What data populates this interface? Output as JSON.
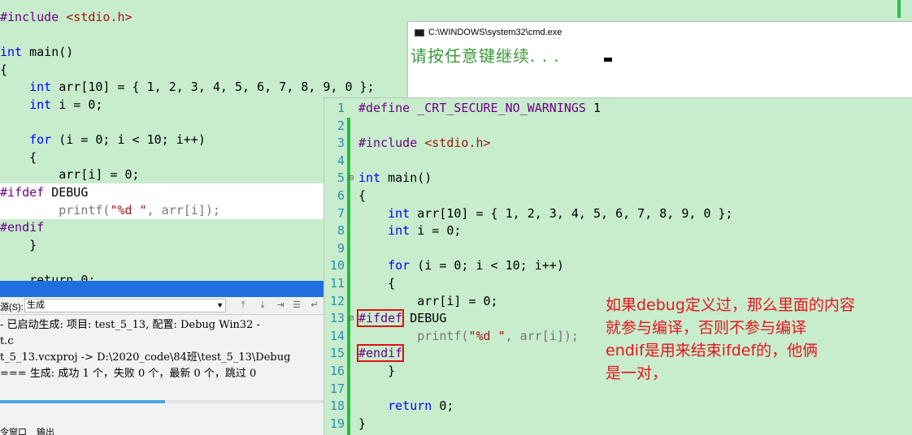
{
  "background_editor": {
    "lines": [
      [
        {
          "t": "#include ",
          "c": "pp"
        },
        {
          "t": "<stdio.h>",
          "c": "str"
        }
      ],
      [],
      [
        {
          "t": "int",
          "c": "kw"
        },
        {
          "t": " main()",
          "c": ""
        }
      ],
      [
        {
          "t": "{",
          "c": ""
        }
      ],
      [
        {
          "t": "    ",
          "c": ""
        },
        {
          "t": "int",
          "c": "kw"
        },
        {
          "t": " arr[10] = { 1, 2, 3, 4, 5, 6, 7, 8, 9, 0 };",
          "c": ""
        }
      ],
      [
        {
          "t": "    ",
          "c": ""
        },
        {
          "t": "int",
          "c": "kw"
        },
        {
          "t": " i = 0;",
          "c": ""
        }
      ],
      [],
      [
        {
          "t": "    ",
          "c": ""
        },
        {
          "t": "for",
          "c": "kw"
        },
        {
          "t": " (i = 0; i < 10; i++)",
          "c": ""
        }
      ],
      [
        {
          "t": "    {",
          "c": ""
        }
      ],
      [
        {
          "t": "        arr[i] = 0;",
          "c": ""
        }
      ],
      [
        {
          "t": "#ifdef",
          "c": "pp"
        },
        {
          "t": " DEBUG",
          "c": ""
        }
      ],
      [
        {
          "t": "        printf(",
          "c": "dim"
        },
        {
          "t": "\"%d \"",
          "c": "str"
        },
        {
          "t": ", arr[i]);",
          "c": "dim"
        }
      ],
      [
        {
          "t": "#endif",
          "c": "pp"
        }
      ],
      [
        {
          "t": "    }",
          "c": ""
        }
      ],
      [],
      [
        {
          "t": "    return 0;",
          "c": ""
        }
      ]
    ]
  },
  "console": {
    "title": "C:\\WINDOWS\\system32\\cmd.exe",
    "icon": "console-icon",
    "message": "请按任意键继续. . ."
  },
  "output_panel": {
    "source_label": "源(S):",
    "source_value": "生成",
    "lines": [
      "- 已启动生成: 项目: test_5_13, 配置: Debug Win32 -",
      "t.c",
      "t_5_13.vcxproj -> D:\\2020_code\\84班\\test_5_13\\Debug",
      "=== 生成: 成功 1 个，失败 0 个，最新 0 个，跳过 0"
    ],
    "progress": 0.51,
    "tabs": [
      "令窗口",
      "输出"
    ]
  },
  "editor": {
    "lines": [
      {
        "n": "1",
        "fold": "",
        "boxed": false,
        "tokens": [
          {
            "t": "#define",
            "c": "pp"
          },
          {
            "t": " ",
            "c": ""
          },
          {
            "t": "_CRT_SECURE_NO_WARNINGS",
            "c": "mac"
          },
          {
            "t": " 1",
            "c": ""
          }
        ]
      },
      {
        "n": "2",
        "fold": "",
        "boxed": false,
        "tokens": []
      },
      {
        "n": "3",
        "fold": "",
        "boxed": false,
        "tokens": [
          {
            "t": "#include",
            "c": "pp"
          },
          {
            "t": " ",
            "c": ""
          },
          {
            "t": "<stdio.h>",
            "c": "str"
          }
        ]
      },
      {
        "n": "4",
        "fold": "",
        "boxed": false,
        "tokens": []
      },
      {
        "n": "5",
        "fold": "⊟",
        "boxed": false,
        "tokens": [
          {
            "t": "int",
            "c": "kw"
          },
          {
            "t": " main()",
            "c": ""
          }
        ]
      },
      {
        "n": "6",
        "fold": "",
        "boxed": false,
        "tokens": [
          {
            "t": "{",
            "c": ""
          }
        ]
      },
      {
        "n": "7",
        "fold": "",
        "boxed": false,
        "tokens": [
          {
            "t": "    ",
            "c": ""
          },
          {
            "t": "int",
            "c": "kw"
          },
          {
            "t": " arr[10] = { 1, 2, 3, 4, 5, 6, 7, 8, 9, 0 };",
            "c": ""
          }
        ]
      },
      {
        "n": "8",
        "fold": "",
        "boxed": false,
        "tokens": [
          {
            "t": "    ",
            "c": ""
          },
          {
            "t": "int",
            "c": "kw"
          },
          {
            "t": " i = 0;",
            "c": ""
          }
        ]
      },
      {
        "n": "9",
        "fold": "",
        "boxed": false,
        "tokens": []
      },
      {
        "n": "10",
        "fold": "",
        "boxed": false,
        "tokens": [
          {
            "t": "    ",
            "c": ""
          },
          {
            "t": "for",
            "c": "kw"
          },
          {
            "t": " (i = 0; i < 10; i++)",
            "c": ""
          }
        ]
      },
      {
        "n": "11",
        "fold": "",
        "boxed": false,
        "tokens": [
          {
            "t": "    {",
            "c": ""
          }
        ]
      },
      {
        "n": "12",
        "fold": "",
        "boxed": false,
        "tokens": [
          {
            "t": "        arr[i] = 0;",
            "c": ""
          }
        ]
      },
      {
        "n": "13",
        "fold": "⊟",
        "boxed": true,
        "tokens": [
          {
            "t": "#ifdef",
            "c": "pp"
          },
          {
            "t": " DEBUG",
            "c": ""
          }
        ]
      },
      {
        "n": "14",
        "fold": "",
        "boxed": false,
        "tokens": [
          {
            "t": "        printf(",
            "c": "dim"
          },
          {
            "t": "\"%d \"",
            "c": "str"
          },
          {
            "t": ", arr[i]);",
            "c": "dim"
          }
        ]
      },
      {
        "n": "15",
        "fold": "",
        "boxed": true,
        "tokens": [
          {
            "t": "#endif",
            "c": "pp"
          }
        ]
      },
      {
        "n": "16",
        "fold": "",
        "boxed": false,
        "tokens": [
          {
            "t": "    }",
            "c": ""
          }
        ]
      },
      {
        "n": "17",
        "fold": "",
        "boxed": false,
        "tokens": []
      },
      {
        "n": "18",
        "fold": "",
        "boxed": false,
        "tokens": [
          {
            "t": "    ",
            "c": ""
          },
          {
            "t": "return",
            "c": "kw"
          },
          {
            "t": " 0;",
            "c": ""
          }
        ]
      },
      {
        "n": "19",
        "fold": "",
        "boxed": false,
        "tokens": [
          {
            "t": "}",
            "c": ""
          }
        ]
      }
    ]
  },
  "annotation": {
    "lines": [
      "如果debug定义过，那么里面的内容",
      "就参与编译，否则不参与编译",
      "endif是用来结束ifdef的，他俩",
      "是一对，"
    ],
    "color": "#e8141e"
  },
  "colors": {
    "editor_bg": "#c7edcc",
    "keyword": "#0000ff",
    "preprocessor": "#6f008a",
    "string": "#a31515",
    "line_number": "#2b91af",
    "change_bar": "#22c03a",
    "highlight_box": "#e01010"
  }
}
